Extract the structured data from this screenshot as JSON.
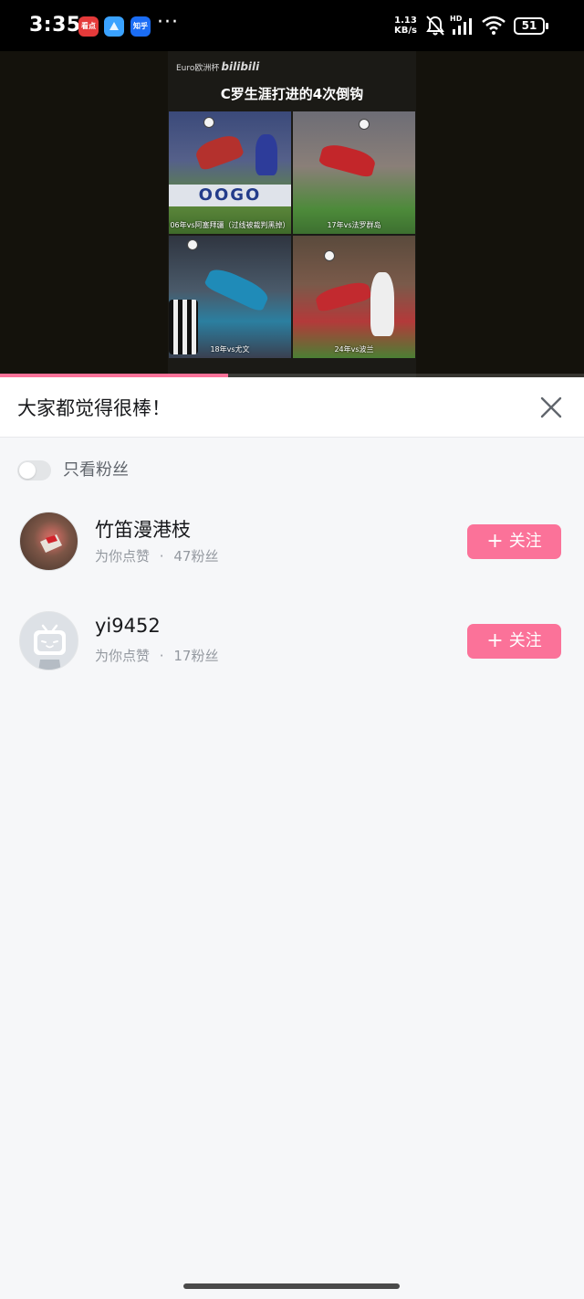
{
  "status_bar": {
    "time": "3:35",
    "apps": [
      "看点",
      "",
      "知乎"
    ],
    "more": "···",
    "net_speed_value": "1.13",
    "net_speed_unit": "KB/s",
    "signal_tag": "HD",
    "battery": "51"
  },
  "video": {
    "brand_prefix": "Euro欧洲杯",
    "brand_logo": "bilibili",
    "title": "C罗生涯打进的4次倒钩",
    "captions": [
      "06年vs阿塞拜疆（过线被裁判黑掉）",
      "17年vs法罗群岛",
      "18年vs尤文",
      "24年vs波兰"
    ],
    "progress_fraction": 0.39,
    "progress_color": "#fb7299"
  },
  "sheet": {
    "title": "大家都觉得很棒！",
    "fans_only_label": "只看粉丝",
    "fans_only_enabled": false,
    "users": [
      {
        "name": "竹笛漫港枝",
        "action": "为你点赞",
        "separator": "·",
        "fans": "47粉丝",
        "follow_label": "关注",
        "avatar": "photo"
      },
      {
        "name": "yi9452",
        "action": "为你点赞",
        "separator": "·",
        "fans": "17粉丝",
        "follow_label": "关注",
        "avatar": "default-tv-icon"
      }
    ]
  },
  "colors": {
    "accent": "#fb7299",
    "text_primary": "#18191c",
    "text_secondary": "#9499a0",
    "background": "#f6f7f9"
  }
}
